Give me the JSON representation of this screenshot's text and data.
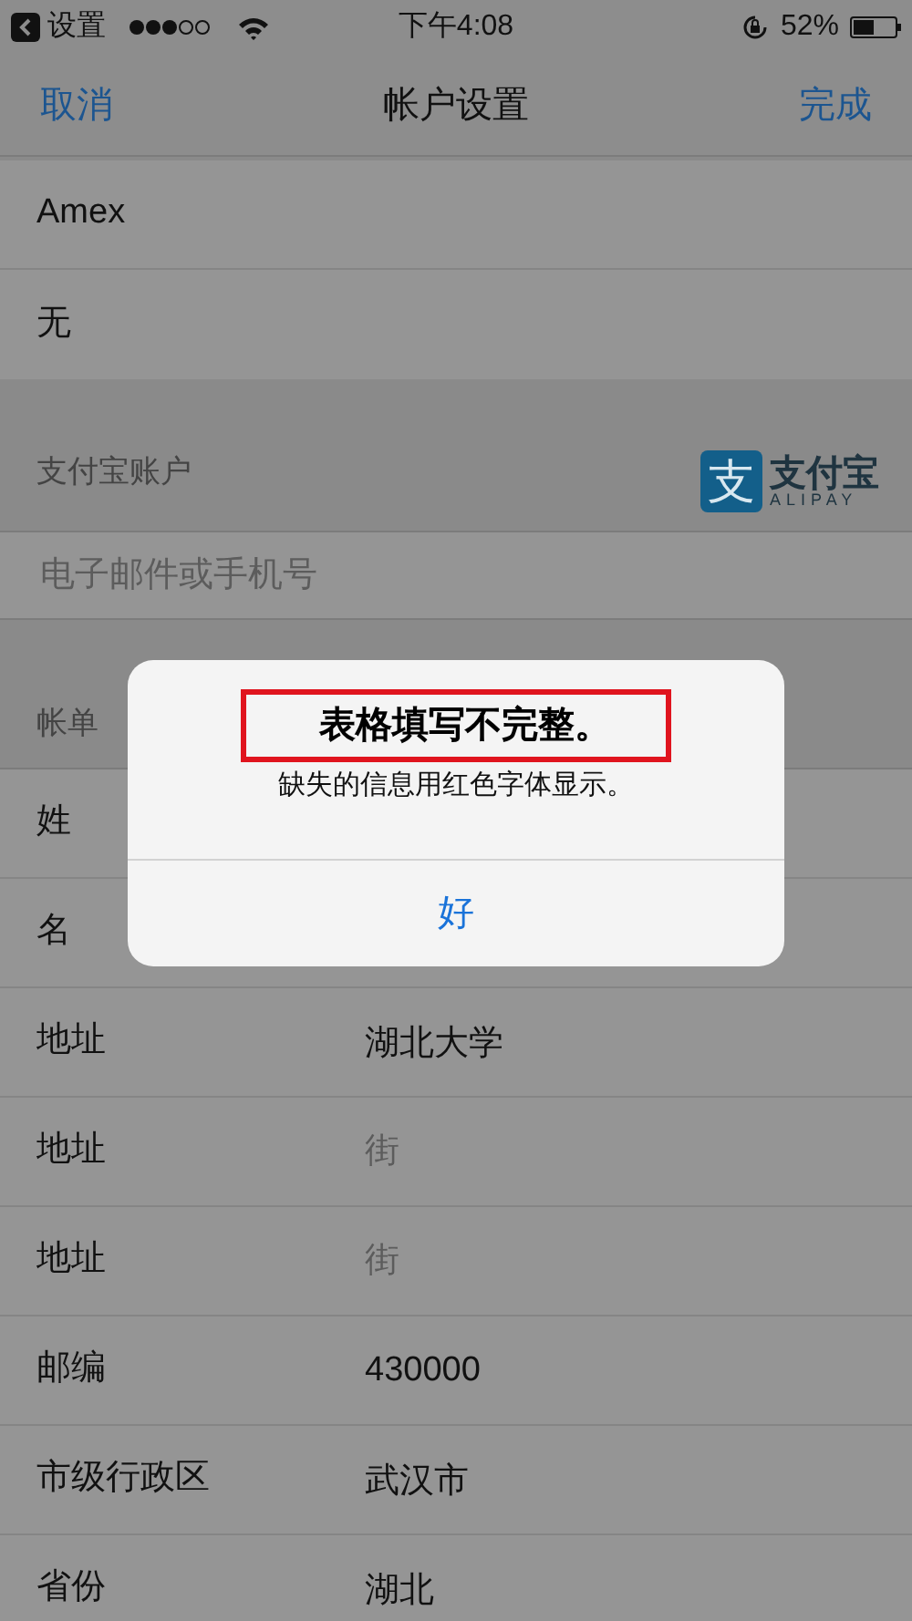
{
  "status_bar": {
    "back_app": "设置",
    "time": "下午4:08",
    "battery": "52%",
    "level": 0.52
  },
  "nav": {
    "cancel": "取消",
    "title": "帐户设置",
    "done": "完成"
  },
  "card_rows": [
    {
      "value": "Amex"
    },
    {
      "value": "无"
    }
  ],
  "alipay": {
    "header": "支付宝账户",
    "logo_mark": "支",
    "logo_text": "支付宝",
    "logo_sub": "ALIPAY",
    "field": {
      "placeholder": "电子邮件或手机号"
    }
  },
  "billing": {
    "header": "帐单",
    "rows": [
      {
        "label": "姓"
      },
      {
        "label": "名"
      },
      {
        "label": "地址",
        "value": "湖北大学"
      },
      {
        "label": "地址",
        "placeholder": "街"
      },
      {
        "label": "地址",
        "placeholder": "街"
      },
      {
        "label": "邮编",
        "value": "430000"
      },
      {
        "label": "市级行政区",
        "value": "武汉市"
      },
      {
        "label": "省份",
        "value": "湖北"
      }
    ]
  },
  "alert": {
    "title": "表格填写不完整。",
    "title_highlighted": true,
    "message": "缺失的信息用红色字体显示。",
    "button": "好"
  }
}
